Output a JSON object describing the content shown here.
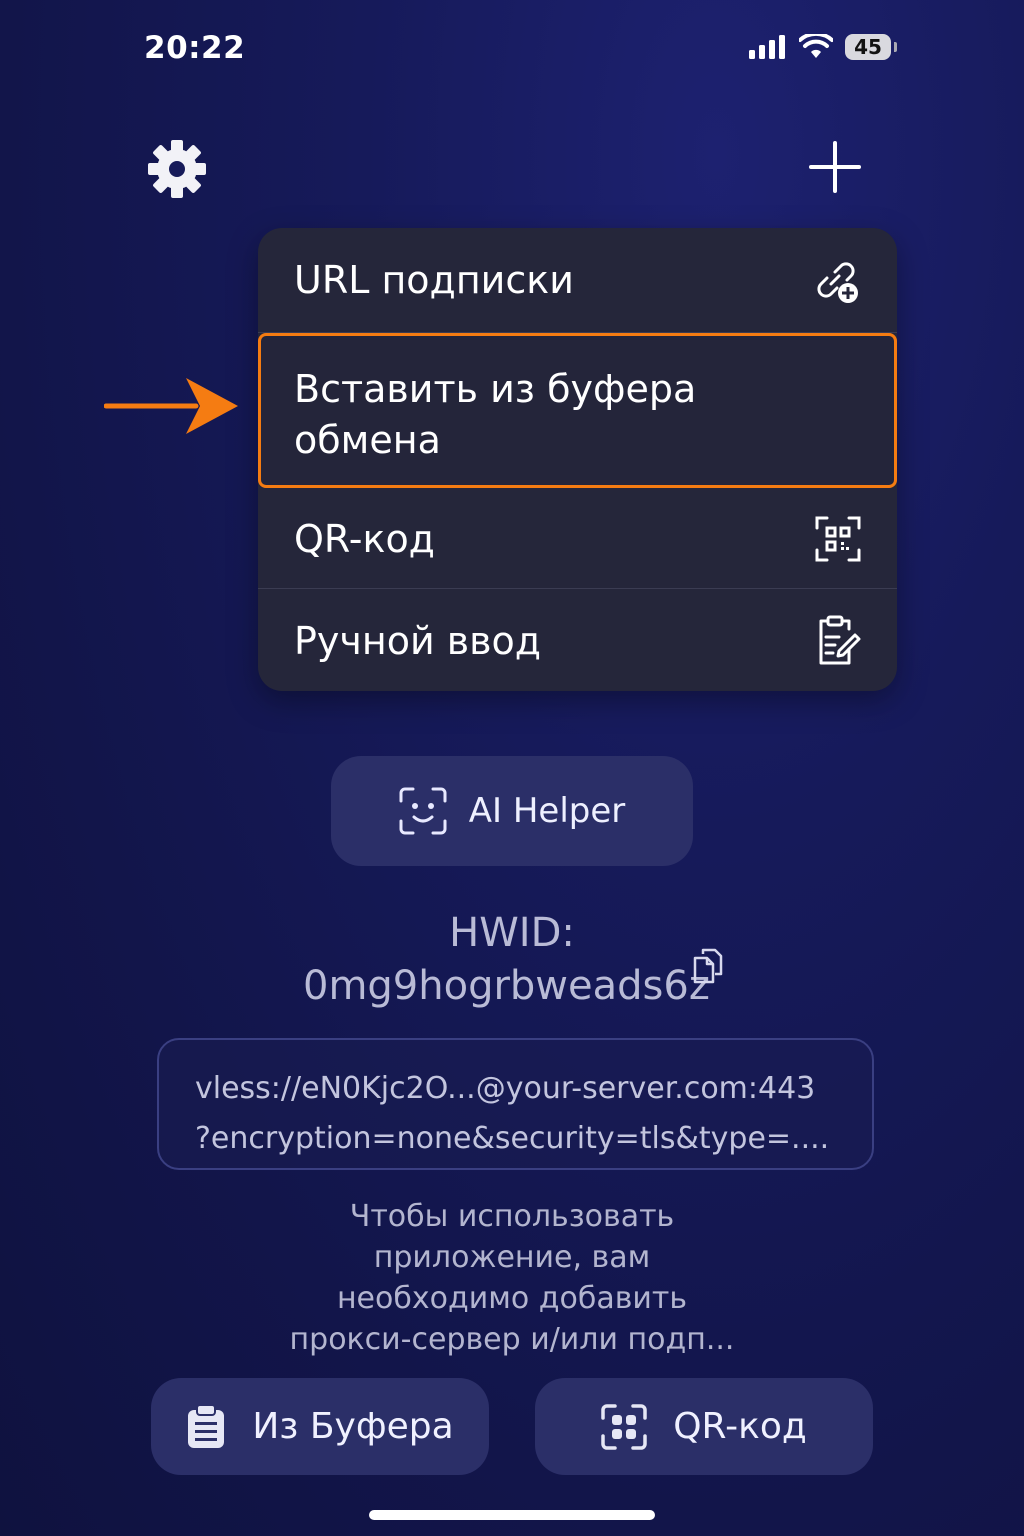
{
  "status_bar": {
    "time": "20:22",
    "battery": "45",
    "icons": [
      "signal-icon",
      "wifi-icon",
      "battery-icon"
    ]
  },
  "top_bar": {
    "settings_icon": "gear-icon",
    "add_icon": "plus-icon"
  },
  "menu": {
    "items": [
      {
        "label": "URL подписки",
        "icon": "link-plus-icon"
      },
      {
        "label_line1": "Вставить из буфера",
        "label_line2": "обмена",
        "highlighted": true
      },
      {
        "label": "QR-код",
        "icon": "qr-code-icon"
      },
      {
        "label": "Ручной ввод",
        "icon": "clipboard-edit-icon"
      }
    ]
  },
  "annotation": {
    "arrow_color": "#f57c12",
    "highlight_color": "#f57c12"
  },
  "ai_helper": {
    "label": "AI Helper",
    "icon": "face-scan-icon"
  },
  "hwid": {
    "label": "HWID:",
    "value": "0mg9hogrbweads6z",
    "copy_icon": "copy-icon"
  },
  "config_preview": {
    "line1": "vless://eN0Kjc2O...@your-server.com:443",
    "line2": "?encryption=none&security=tls&type=...."
  },
  "hint": {
    "line1": "Чтобы использовать",
    "line2": "приложение, вам",
    "line3": "необходимо добавить",
    "line4": "прокси-сервер и/или подп..."
  },
  "bottom_buttons": {
    "clipboard_label": "Из Буфера",
    "clipboard_icon": "clipboard-icon",
    "qr_label": "QR-код",
    "qr_icon": "qr-scan-icon"
  },
  "colors": {
    "background": "#151956",
    "menu_bg": "#25263a",
    "button_bg": "#2b2f68",
    "accent_orange": "#f57c12"
  }
}
